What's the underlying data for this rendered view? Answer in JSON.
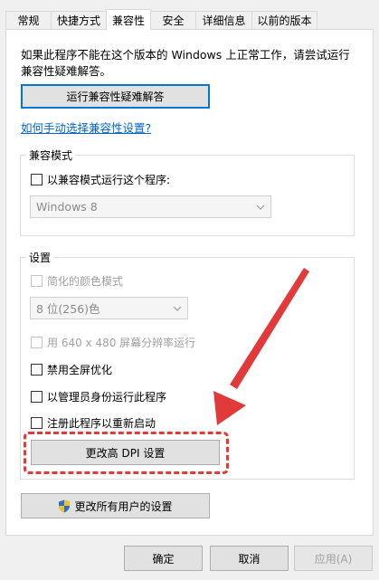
{
  "tabs": [
    {
      "label": "常规"
    },
    {
      "label": "快捷方式"
    },
    {
      "label": "兼容性"
    },
    {
      "label": "安全"
    },
    {
      "label": "详细信息"
    },
    {
      "label": "以前的版本"
    }
  ],
  "intro_text": "如果此程序不能在这个版本的 Windows 上正常工作，请尝试运行兼容性疑难解答。",
  "troubleshoot_button": "运行兼容性疑难解答",
  "manual_link": "如何手动选择兼容性设置?",
  "compat_mode": {
    "legend": "兼容模式",
    "checkbox_label": "以兼容模式运行这个程序:",
    "select_value": "Windows 8"
  },
  "settings": {
    "legend": "设置",
    "reduced_color_label": "简化的颜色模式",
    "color_select_value": "8 位(256)色",
    "res_640_label": "用 640 x 480 屏幕分辨率运行",
    "disable_fullscreen_label": "禁用全屏优化",
    "run_as_admin_label": "以管理员身份运行此程序",
    "register_restart_label": "注册此程序以重新启动",
    "dpi_button": "更改高 DPI 设置"
  },
  "all_users_button": "更改所有用户的设置",
  "footer": {
    "ok": "确定",
    "cancel": "取消",
    "apply": "应用(A)"
  },
  "colors": {
    "annotation_red": "#e23a3a",
    "focus_blue": "#0078d7",
    "link_blue": "#0066cc"
  }
}
